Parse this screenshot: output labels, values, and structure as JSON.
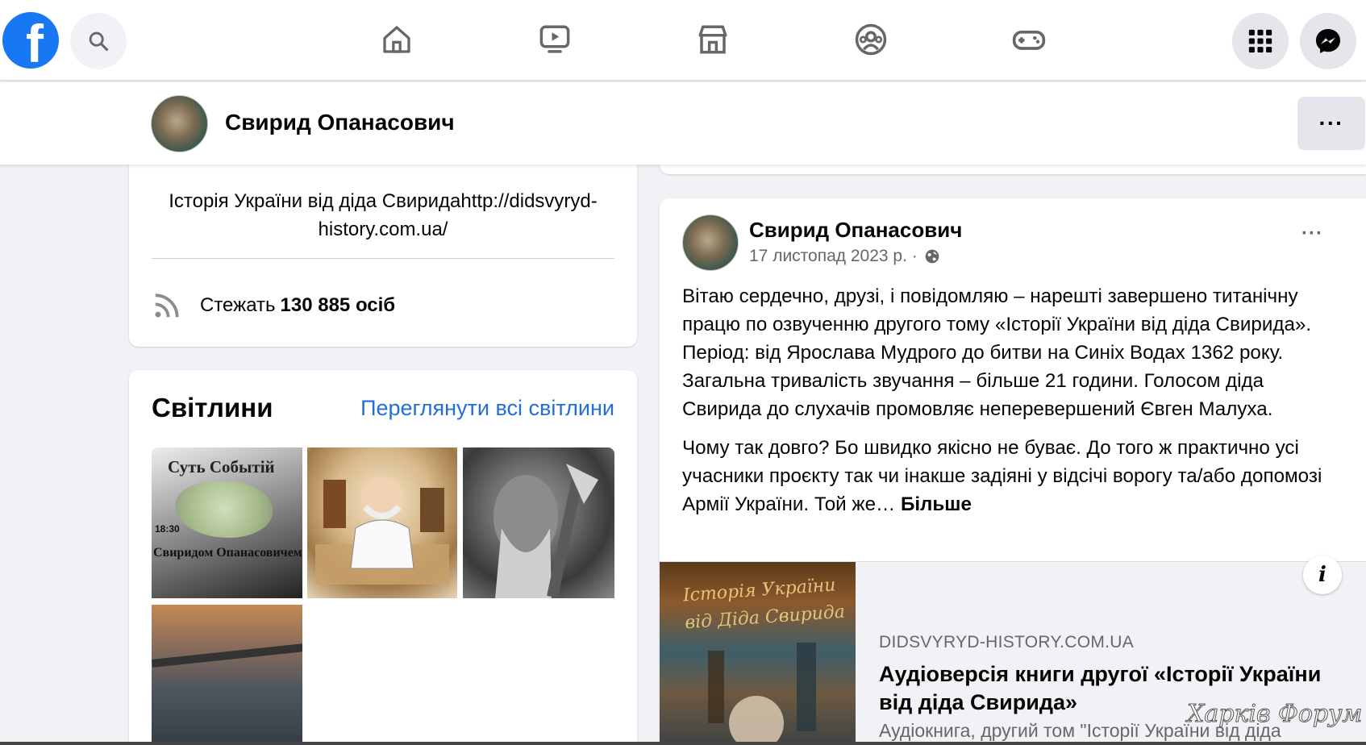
{
  "app": {
    "logo_letter": "f"
  },
  "topnav": {
    "icons": [
      "home-icon",
      "watch-icon",
      "marketplace-icon",
      "groups-icon",
      "gaming-icon"
    ],
    "right_buttons": [
      "menu-grid-icon",
      "messenger-icon"
    ]
  },
  "profile_header": {
    "name": "Свирид Опанасович",
    "more_label": "···"
  },
  "intro": {
    "bio": "Історія України від діда Свиридаhttp://didsvyryd-history.com.ua/",
    "follow_prefix": "Стежать",
    "follow_count": "130 885 осіб"
  },
  "photos": {
    "title": "Світлини",
    "see_all": "Переглянути всі світлини",
    "photo1_caption_top": "Суть Событій",
    "photo1_caption_bottom": "Свиридом Опанасовичем",
    "photo1_time": "18:30"
  },
  "post": {
    "author": "Свирид Опанасович",
    "date": "17 листопад 2023 р. ·",
    "dots": "···",
    "paragraph1": "Вітаю сердечно, друзі, і повідомляю – нарешті завершено титанічну працю по озвученню другого тому «Історії України від діда Свирида». Період: від Ярослава Мудрого до битви на Синіх Водах 1362 року. Загальна тривалість звучання – більше 21 години. Голосом діда Свирида до слухачів промовляє неперевершений Євген Малуха.",
    "paragraph2": "Чому так довго? Бо швидко якісно не буває. До того ж практично усі учасники проєкту так чи інакше задіяні у відсічі ворогу та/або допомозі Армії України. Той же…",
    "see_more": "Більше"
  },
  "link_preview": {
    "book_title": "Історія України від Діда Свирида",
    "info_label": "i",
    "domain": "DIDSVYRYD-HISTORY.COM.UA",
    "title": "Аудіоверсія книги другої «Історії України від діда Свирида»",
    "subtitle": "Аудіокнига, другий том \"Історії України від діда"
  },
  "watermark": "Харків Форум",
  "colors": {
    "brand": "#1877f2",
    "link": "#216fdb",
    "secondary_text": "#65676b",
    "background": "#f0f2f5"
  }
}
